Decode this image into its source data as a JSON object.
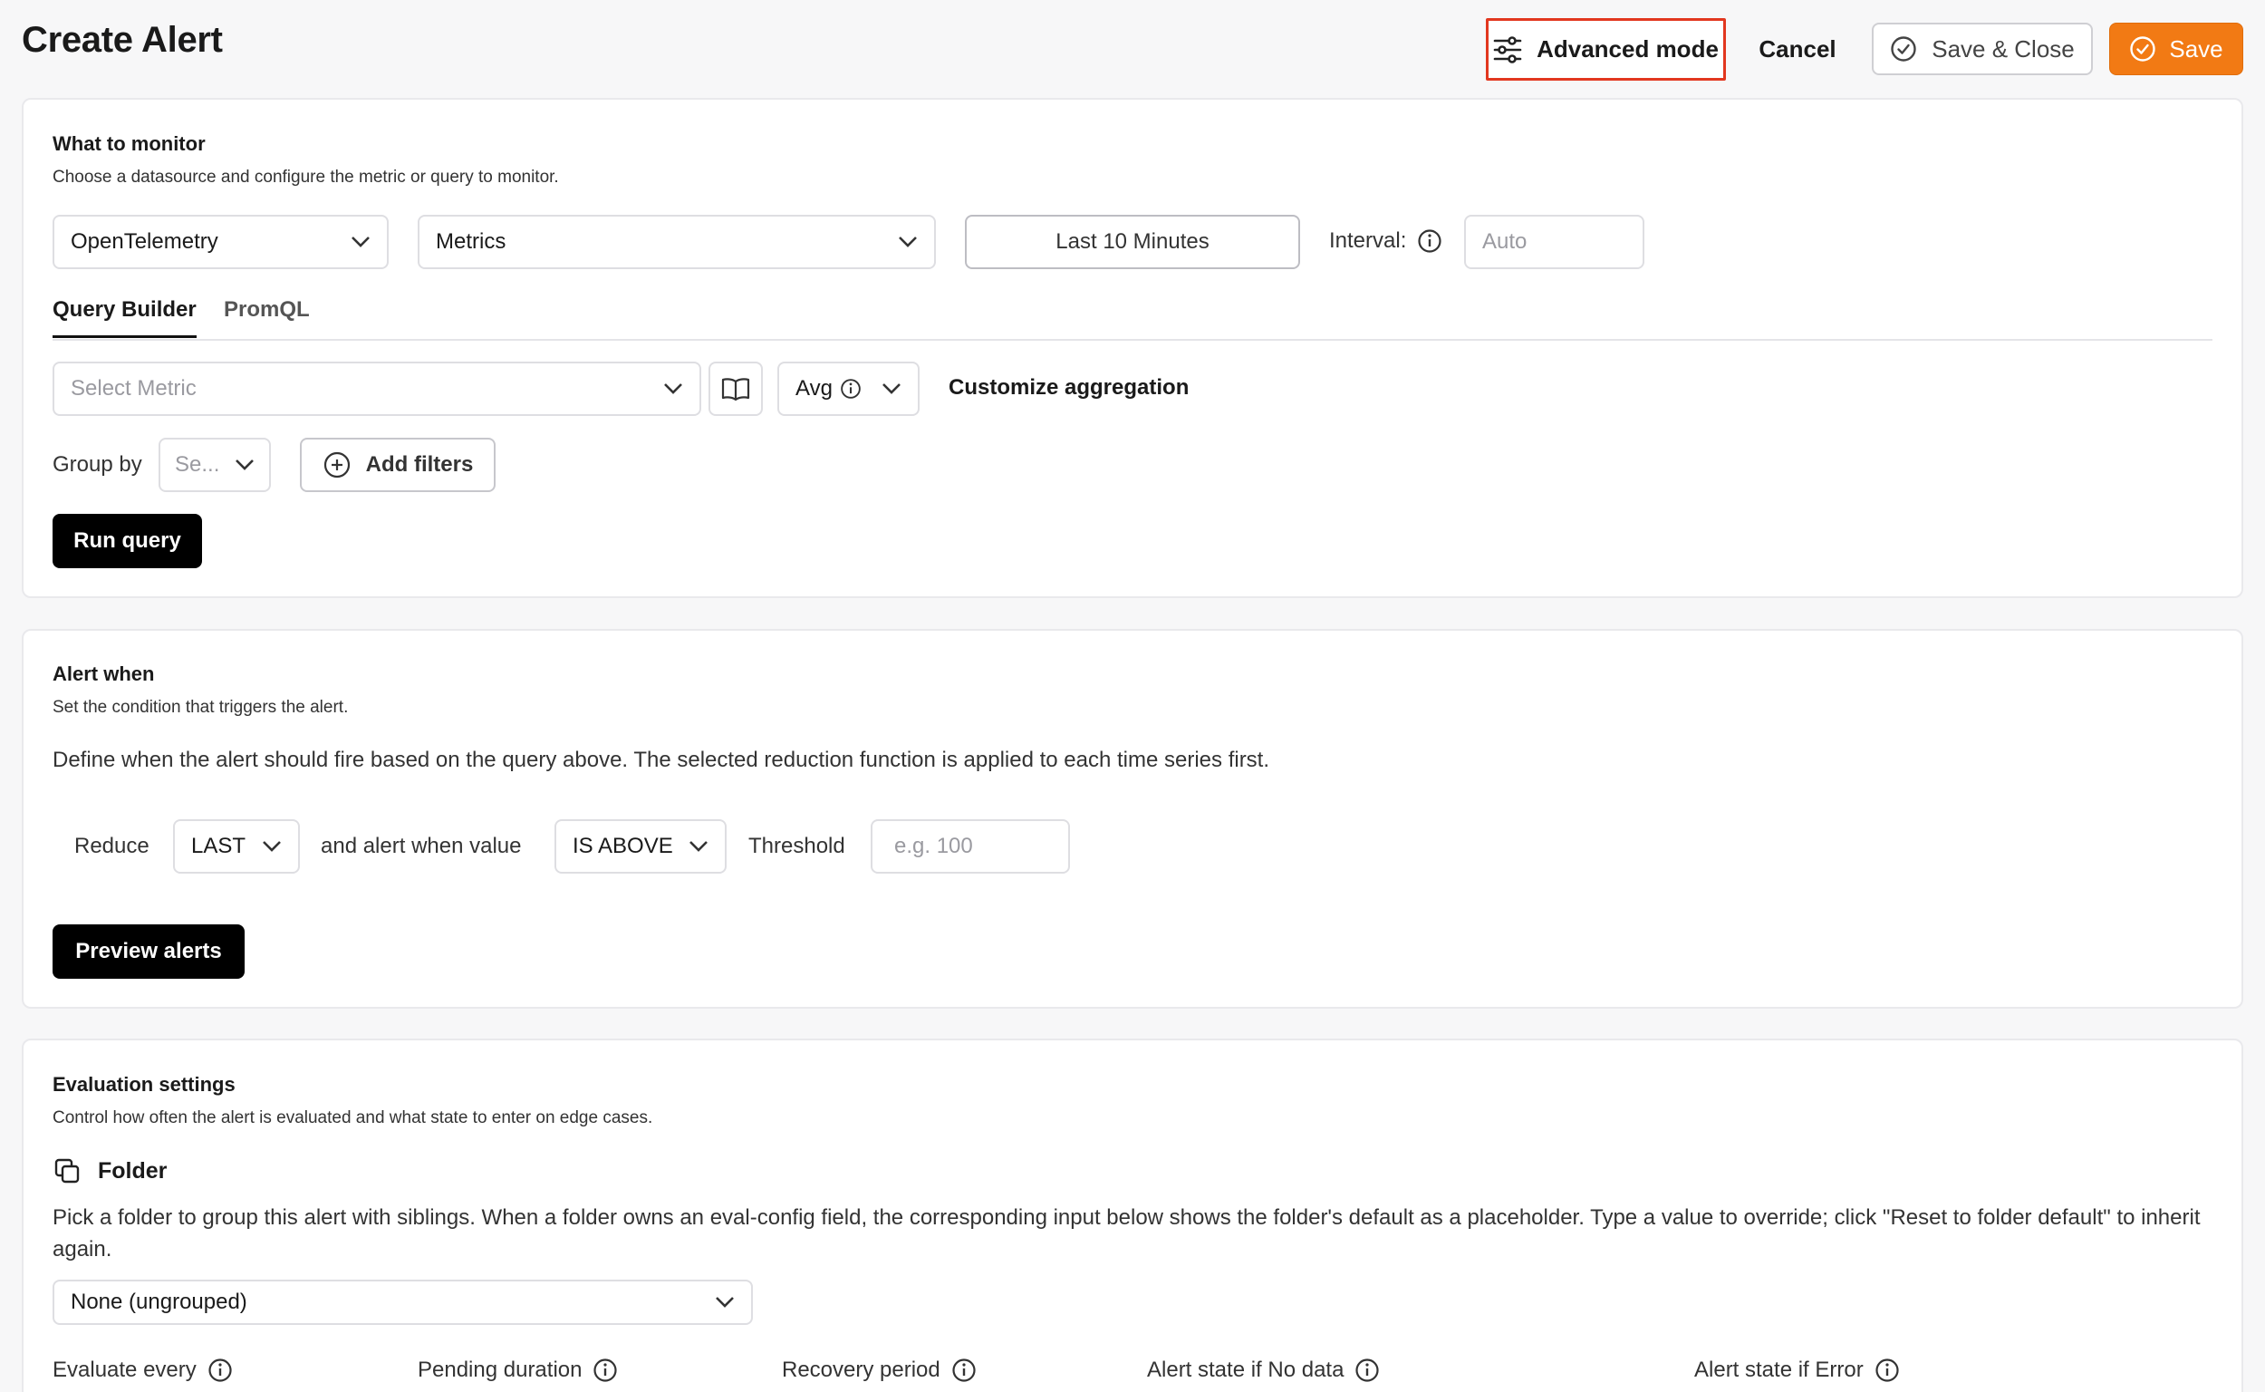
{
  "header": {
    "title": "Create Alert",
    "advanced_mode": "Advanced mode",
    "cancel": "Cancel",
    "save_close": "Save & Close",
    "save": "Save"
  },
  "monitor": {
    "title": "What to monitor",
    "desc": "Choose a datasource and configure the metric or query to monitor.",
    "datasource": "OpenTelemetry",
    "signal": "Metrics",
    "time_range": "Last 10 Minutes",
    "interval_label": "Interval:",
    "interval_placeholder": "Auto",
    "tabs": [
      "Query Builder",
      "PromQL"
    ],
    "metric_placeholder": "Select Metric",
    "aggregation": "Avg",
    "customize_aggregation": "Customize aggregation",
    "group_by_label": "Group by",
    "group_by_placeholder": "Se...",
    "add_filters": "Add filters",
    "run_query": "Run query"
  },
  "alert_when": {
    "title": "Alert when",
    "desc": "Set the condition that triggers the alert.",
    "explain": "Define when the alert should fire based on the query above. The selected reduction function is applied to each time series first.",
    "reduce_label": "Reduce",
    "reduce_value": "LAST",
    "alert_when_value_label": "and alert when value",
    "comparator": "IS ABOVE",
    "threshold_label": "Threshold",
    "threshold_placeholder": "e.g. 100",
    "preview": "Preview alerts"
  },
  "evaluation": {
    "title": "Evaluation settings",
    "desc": "Control how often the alert is evaluated and what state to enter on edge cases.",
    "folder_label": "Folder",
    "folder_help": "Pick a folder to group this alert with siblings. When a folder owns an eval-config field, the corresponding input below shows the folder's default as a placeholder. Type a value to override; click \"Reset to folder default\" to inherit again.",
    "folder_value": "None (ungrouped)",
    "columns": [
      "Evaluate every",
      "Pending duration",
      "Recovery period",
      "Alert state if No data",
      "Alert state if Error"
    ]
  },
  "colors": {
    "accent": "#f27a14",
    "highlight_border": "#e2371f"
  }
}
